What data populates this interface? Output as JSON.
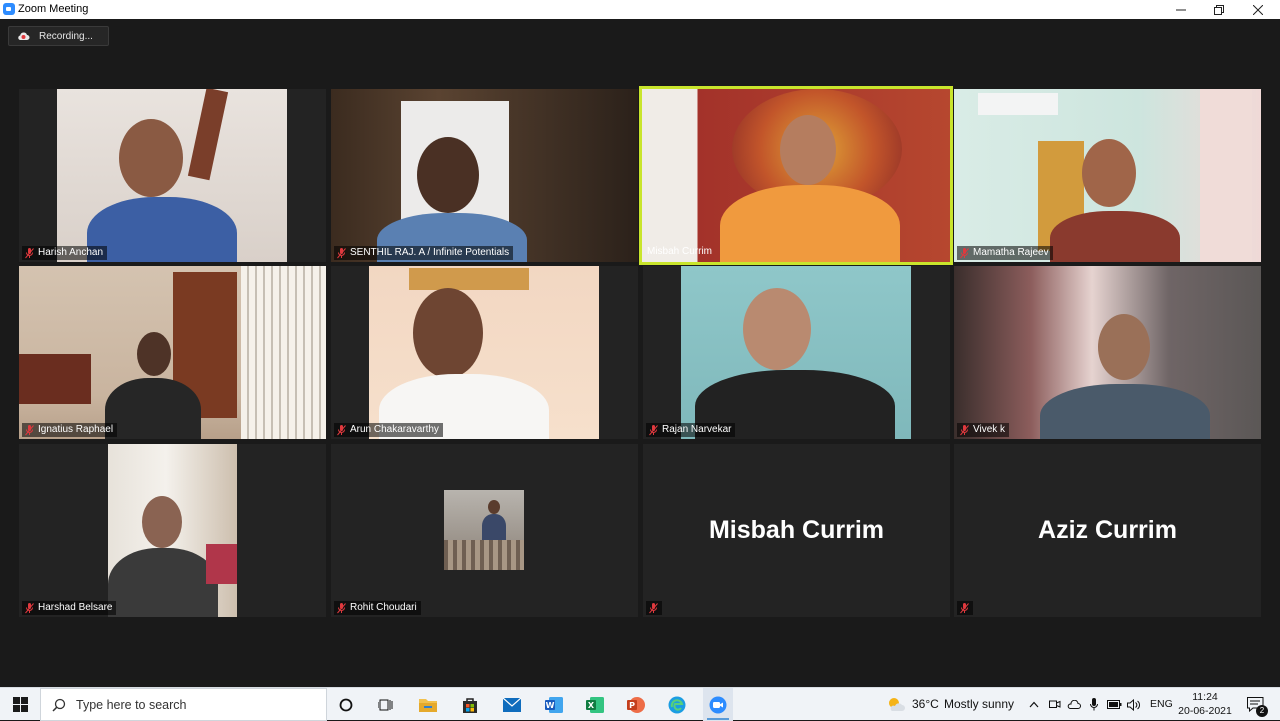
{
  "window": {
    "title": "Zoom Meeting",
    "controls": {
      "minimize": "–",
      "restore": "❐",
      "close": "✕"
    }
  },
  "recording": {
    "label": "Recording..."
  },
  "participants": [
    {
      "name": "Harish Anchan",
      "muted": true,
      "video": true
    },
    {
      "name": "SENTHIL RAJ. A / Infinite Potentials",
      "muted": true,
      "video": true
    },
    {
      "name": "Misbah Currim",
      "muted": false,
      "video": true,
      "active_speaker": true
    },
    {
      "name": "Mamatha Rajeev",
      "muted": true,
      "video": true
    },
    {
      "name": "Ignatius Raphael",
      "muted": true,
      "video": true
    },
    {
      "name": "Arun Chakaravarthy",
      "muted": true,
      "video": true
    },
    {
      "name": "Rajan Narvekar",
      "muted": true,
      "video": true
    },
    {
      "name": "Vivek k",
      "muted": true,
      "video": true
    },
    {
      "name": "Harshad Belsare",
      "muted": true,
      "video": true
    },
    {
      "name": "Rohit Choudari",
      "muted": true,
      "video": false,
      "has_profile_photo": true
    },
    {
      "name": "Misbah Currim",
      "muted": true,
      "video": false,
      "display_name": "Misbah Currim"
    },
    {
      "name": "Aziz Currim",
      "muted": true,
      "video": false,
      "display_name": "Aziz Currim"
    }
  ],
  "taskbar": {
    "search_placeholder": "Type here to search",
    "weather_temp": "36°C",
    "weather_desc": "Mostly sunny",
    "language": "ENG",
    "time": "11:24",
    "date": "20-06-2021",
    "notification_count": "2",
    "pinned_apps": [
      "cortana-icon",
      "task-view-icon",
      "file-explorer-icon",
      "store-icon",
      "mail-icon",
      "word-icon",
      "excel-icon",
      "powerpoint-icon",
      "edge-icon",
      "zoom-icon"
    ]
  },
  "colors": {
    "active_speaker_border": "#c9e52c",
    "mute_icon": "#e0393e",
    "zoom_blue": "#2d8cff"
  }
}
